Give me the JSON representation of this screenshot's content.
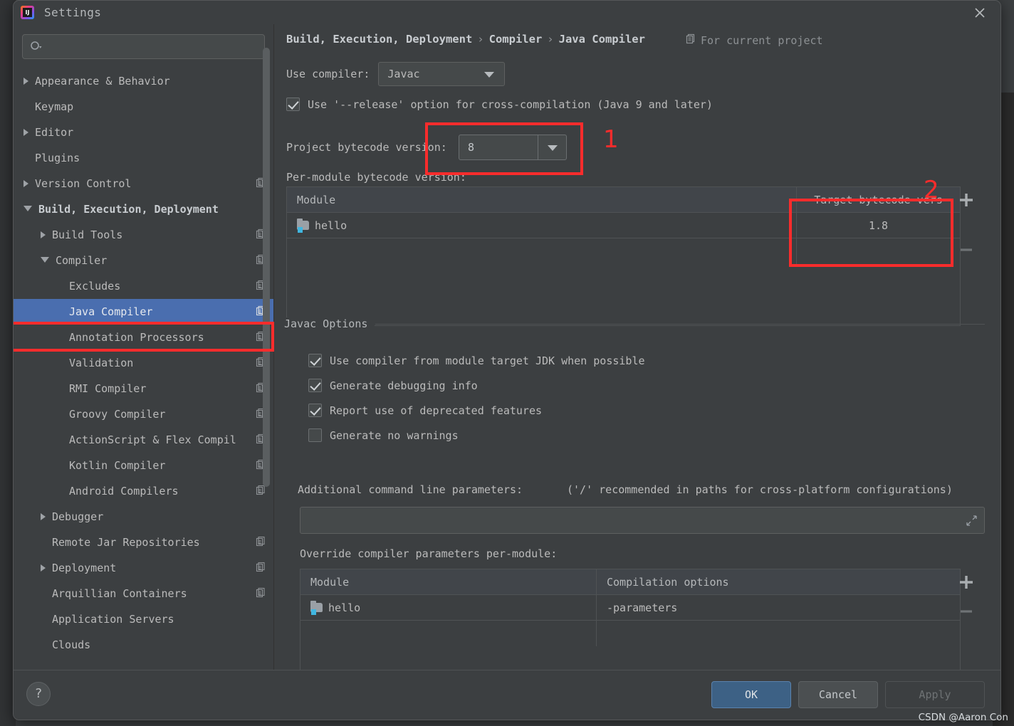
{
  "window": {
    "title": "Settings",
    "logo_icon": "intellij-idea-logo",
    "close_icon": "close-icon"
  },
  "sidebar": {
    "search": {
      "placeholder": "",
      "value": "",
      "icon": "search-icon"
    },
    "items": [
      {
        "label": "Appearance & Behavior",
        "arrow": "collapsed",
        "indent": 0,
        "copy": false,
        "bold": false,
        "selected": false
      },
      {
        "label": "Keymap",
        "arrow": "none",
        "indent": 0,
        "copy": false,
        "bold": false,
        "selected": false
      },
      {
        "label": "Editor",
        "arrow": "collapsed",
        "indent": 0,
        "copy": false,
        "bold": false,
        "selected": false
      },
      {
        "label": "Plugins",
        "arrow": "none",
        "indent": 0,
        "copy": false,
        "bold": false,
        "selected": false
      },
      {
        "label": "Version Control",
        "arrow": "collapsed",
        "indent": 0,
        "copy": true,
        "bold": false,
        "selected": false
      },
      {
        "label": "Build, Execution, Deployment",
        "arrow": "expanded",
        "indent": 0,
        "copy": false,
        "bold": true,
        "selected": false
      },
      {
        "label": "Build Tools",
        "arrow": "collapsed",
        "indent": 1,
        "copy": true,
        "bold": false,
        "selected": false
      },
      {
        "label": "Compiler",
        "arrow": "expanded",
        "indent": 1,
        "copy": true,
        "bold": false,
        "selected": false
      },
      {
        "label": "Excludes",
        "arrow": "none",
        "indent": 2,
        "copy": true,
        "bold": false,
        "selected": false
      },
      {
        "label": "Java Compiler",
        "arrow": "none",
        "indent": 2,
        "copy": true,
        "bold": false,
        "selected": true
      },
      {
        "label": "Annotation Processors",
        "arrow": "none",
        "indent": 2,
        "copy": true,
        "bold": false,
        "selected": false
      },
      {
        "label": "Validation",
        "arrow": "none",
        "indent": 2,
        "copy": true,
        "bold": false,
        "selected": false
      },
      {
        "label": "RMI Compiler",
        "arrow": "none",
        "indent": 2,
        "copy": true,
        "bold": false,
        "selected": false
      },
      {
        "label": "Groovy Compiler",
        "arrow": "none",
        "indent": 2,
        "copy": true,
        "bold": false,
        "selected": false
      },
      {
        "label": "ActionScript & Flex Compil",
        "arrow": "none",
        "indent": 2,
        "copy": true,
        "bold": false,
        "selected": false
      },
      {
        "label": "Kotlin Compiler",
        "arrow": "none",
        "indent": 2,
        "copy": true,
        "bold": false,
        "selected": false
      },
      {
        "label": "Android Compilers",
        "arrow": "none",
        "indent": 2,
        "copy": true,
        "bold": false,
        "selected": false
      },
      {
        "label": "Debugger",
        "arrow": "collapsed",
        "indent": 1,
        "copy": false,
        "bold": false,
        "selected": false
      },
      {
        "label": "Remote Jar Repositories",
        "arrow": "none",
        "indent": 1,
        "copy": true,
        "bold": false,
        "selected": false
      },
      {
        "label": "Deployment",
        "arrow": "collapsed",
        "indent": 1,
        "copy": true,
        "bold": false,
        "selected": false
      },
      {
        "label": "Arquillian Containers",
        "arrow": "none",
        "indent": 1,
        "copy": true,
        "bold": false,
        "selected": false
      },
      {
        "label": "Application Servers",
        "arrow": "none",
        "indent": 1,
        "copy": false,
        "bold": false,
        "selected": false
      },
      {
        "label": "Clouds",
        "arrow": "none",
        "indent": 1,
        "copy": false,
        "bold": false,
        "selected": false
      }
    ]
  },
  "main": {
    "breadcrumb": {
      "part1": "Build, Execution, Deployment",
      "sep1": "›",
      "part2": "Compiler",
      "sep2": "›",
      "part3": "Java Compiler"
    },
    "for_project": {
      "label": "For current project",
      "icon": "copy-scope-icon"
    },
    "use_compiler": {
      "label": "Use compiler:",
      "value": "Javac",
      "caret_icon": "chevron-down-icon"
    },
    "release_option": {
      "label": "Use '--release' option for cross-compilation (Java 9 and later)",
      "checked": true
    },
    "project_bytecode": {
      "label": "Project bytecode version:",
      "value": "8",
      "caret_icon": "chevron-down-icon"
    },
    "per_module_label": "Per-module bytecode version:",
    "per_module_table": {
      "columns": [
        "Module",
        "Target bytecode vers"
      ],
      "rows": [
        {
          "module": "hello",
          "target": "1.8"
        }
      ],
      "add_icon": "plus-icon",
      "remove_icon": "minus-icon"
    },
    "javac_options": {
      "legend": "Javac Options",
      "checkboxes": [
        {
          "label": "Use compiler from module target JDK when possible",
          "checked": true
        },
        {
          "label": "Generate debugging info",
          "checked": true
        },
        {
          "label": "Report use of deprecated features",
          "checked": true
        },
        {
          "label": "Generate no warnings",
          "checked": false
        }
      ],
      "additional_params_label": "Additional command line parameters:",
      "additional_params_hint": "('/' recommended in paths for cross-platform configurations)",
      "additional_params_value": "",
      "expand_icon": "expand-editor-icon",
      "override_label": "Override compiler parameters per-module:",
      "override_table": {
        "columns": [
          "Module",
          "Compilation options"
        ],
        "rows": [
          {
            "module": "hello",
            "options": "-parameters"
          }
        ],
        "add_icon": "plus-icon",
        "remove_icon": "minus-icon"
      }
    }
  },
  "annotations": [
    {
      "id": "1",
      "label": "1"
    },
    {
      "id": "2",
      "label": "2"
    }
  ],
  "footer": {
    "help_label": "?",
    "ok_label": "OK",
    "cancel_label": "Cancel",
    "apply_label": "Apply"
  },
  "watermark": "CSDN @Aaron Con",
  "colors": {
    "accent_blue": "#4a6eaf",
    "annotation_red": "#fa2c2c",
    "panel_bg": "#3c3f41",
    "ok_button": "#3d6185"
  }
}
